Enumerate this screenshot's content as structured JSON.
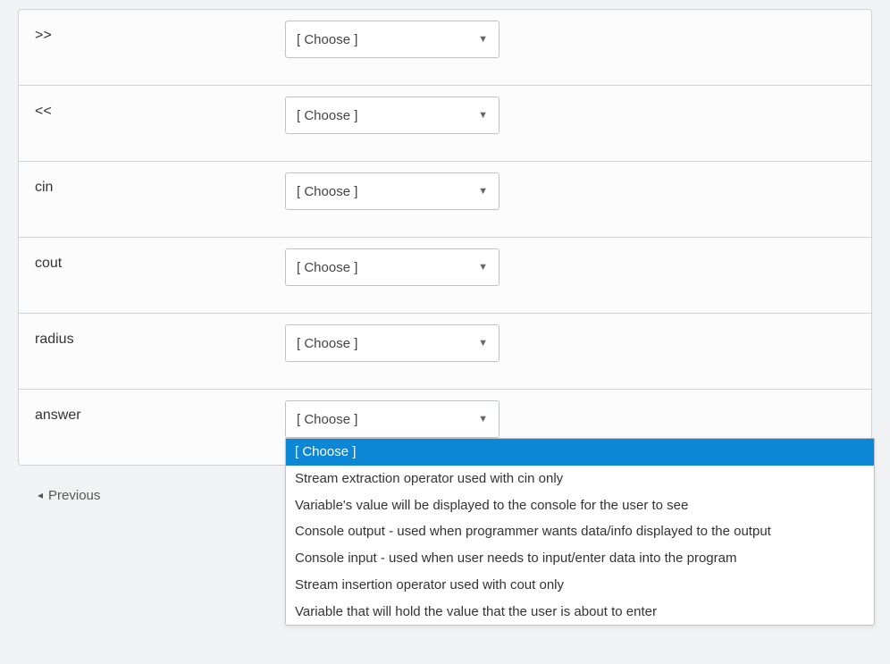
{
  "select_placeholder": "[ Choose ]",
  "rows": [
    {
      "term": ">>"
    },
    {
      "term": "<<"
    },
    {
      "term": "cin"
    },
    {
      "term": "cout"
    },
    {
      "term": "radius"
    },
    {
      "term": "answer"
    }
  ],
  "dropdown_options": [
    "[ Choose ]",
    "Stream extraction operator used with cin only",
    "Variable's value will be displayed to the console for the user to see",
    "Console output - used when programmer wants data/info displayed to the output",
    "Console input - used when user needs to input/enter data into the program",
    "Stream insertion operator used with cout only",
    "Variable that will hold the value that the user is about to enter"
  ],
  "nav": {
    "previous": "Previous"
  }
}
